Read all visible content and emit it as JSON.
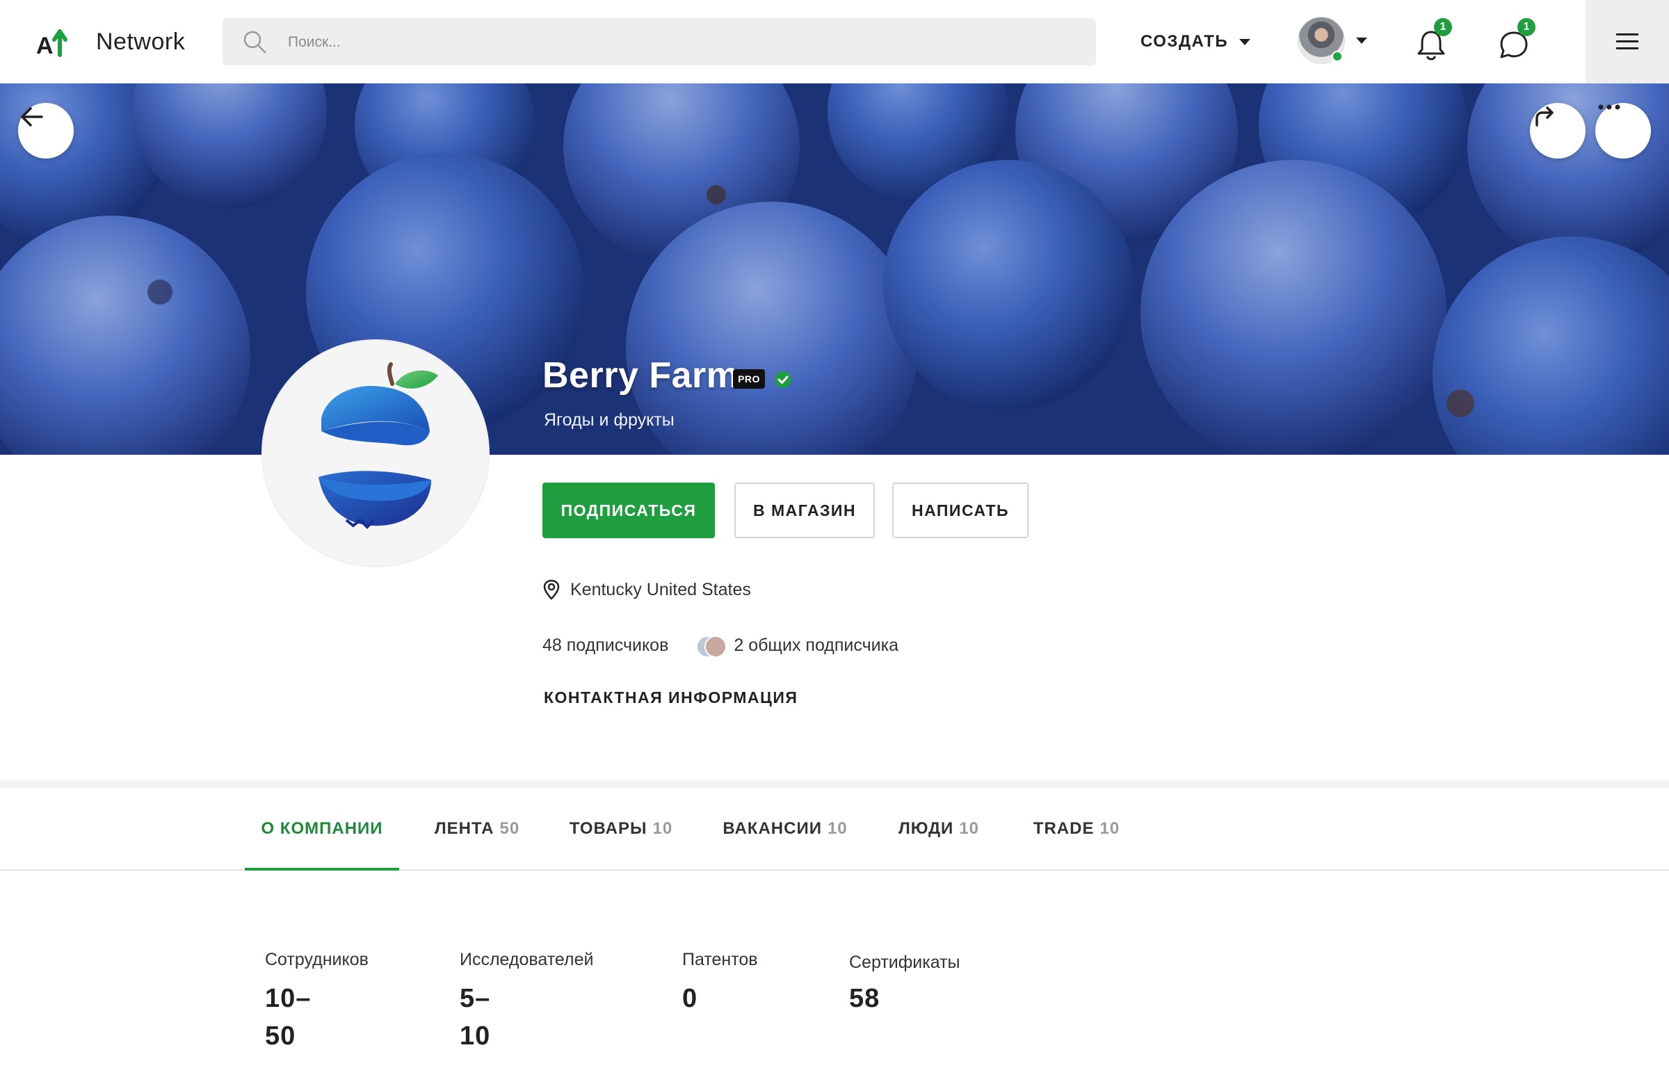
{
  "header": {
    "brand_name": "Network",
    "search_placeholder": "Поиск...",
    "create_label": "СОЗДАТЬ",
    "notifications_count": "1",
    "messages_count": "1"
  },
  "profile": {
    "name": "Berry Farm",
    "pro_label": "PRO",
    "subtitle": "Ягоды и фрукты",
    "location": "Kentucky United States",
    "followers": "48 подписчиков",
    "mutual_followers": "2 общих подписчика",
    "contact_label": "КОНТАКТНАЯ ИНФОРМАЦИЯ"
  },
  "actions": {
    "subscribe": "ПОДПИСАТЬСЯ",
    "shop": "В МАГАЗИН",
    "write": "НАПИСАТЬ"
  },
  "tabs": [
    {
      "label": "О КОМПАНИИ",
      "count": ""
    },
    {
      "label": "ЛЕНТА",
      "count": "50"
    },
    {
      "label": "ТОВАРЫ",
      "count": "10"
    },
    {
      "label": "ВАКАНСИИ",
      "count": "10"
    },
    {
      "label": "ЛЮДИ",
      "count": "10"
    },
    {
      "label": "TRADE",
      "count": "10"
    }
  ],
  "stats": [
    {
      "label": "Сотрудников",
      "value_line1": "10–",
      "value_line2": "50"
    },
    {
      "label": "Исследователей",
      "value_line1": "5–",
      "value_line2": "10"
    },
    {
      "label": "Патентов",
      "value_line1": "0",
      "value_line2": ""
    },
    {
      "label": "Сертификаты",
      "value_line1": "58",
      "value_line2": ""
    }
  ],
  "colors": {
    "accent_green": "#1f9e3f",
    "cover_blue": "#2a4fae"
  },
  "icons": {
    "back": "arrow-left-icon",
    "share": "share-arrow-icon",
    "more": "more-dots-icon",
    "search": "search-icon",
    "bell": "bell-icon",
    "chat": "chat-bubble-icon",
    "menu": "hamburger-icon",
    "location": "map-pin-icon",
    "verified": "verified-check-icon"
  }
}
